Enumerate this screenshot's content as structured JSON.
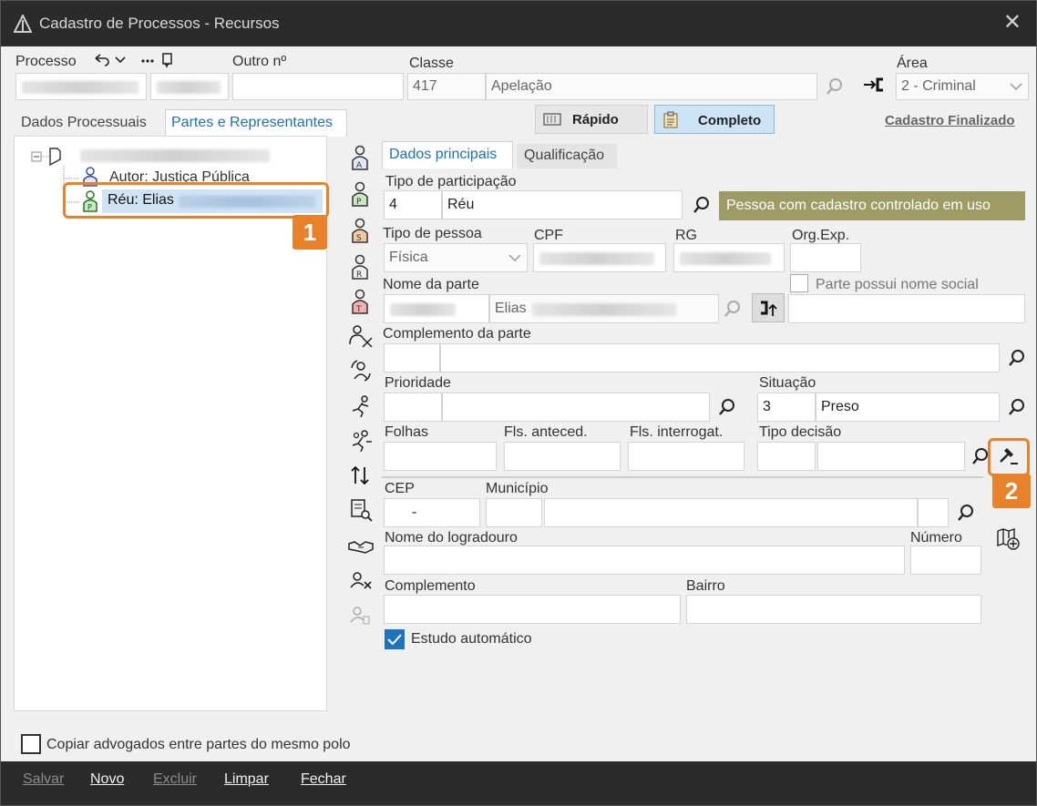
{
  "window": {
    "title": "Cadastro de Processos - Recursos",
    "close": "✕"
  },
  "header": {
    "processo_label": "Processo",
    "outro_label": "Outro nº",
    "classe_label": "Classe",
    "classe_code": "417",
    "classe_name": "Apelação",
    "area_label": "Área",
    "area_value": "2 - Criminal"
  },
  "tabs": {
    "dados_processuais": "Dados Processuais",
    "partes": "Partes e Representantes"
  },
  "mode": {
    "rapido": "Rápido",
    "completo": "Completo",
    "finalizado": "Cadastro Finalizado"
  },
  "tree": {
    "autor": "Autor: Justiça Pública",
    "reu": "Réu: Elias"
  },
  "subtabs": {
    "principais": "Dados principais",
    "qualificacao": "Qualificação"
  },
  "form": {
    "tipo_participacao_label": "Tipo de participação",
    "tipo_participacao_code": "4",
    "tipo_participacao_value": "Réu",
    "controlled_msg": "Pessoa com cadastro controlado em uso",
    "tipo_pessoa_label": "Tipo de pessoa",
    "tipo_pessoa_value": "Física",
    "cpf_label": "CPF",
    "rg_label": "RG",
    "orgexp_label": "Org.Exp.",
    "nome_parte_label": "Nome da parte",
    "nome_parte_value": "Elias",
    "nome_social_label": "Parte possui nome social",
    "complemento_parte_label": "Complemento da parte",
    "prioridade_label": "Prioridade",
    "situacao_label": "Situação",
    "situacao_code": "3",
    "situacao_value": "Preso",
    "folhas_label": "Folhas",
    "fls_anteced_label": "Fls. anteced.",
    "fls_interrog_label": "Fls. interrogat.",
    "tipo_decisao_label": "Tipo decisão",
    "cep_label": "CEP",
    "cep_value": "-",
    "municipio_label": "Município",
    "logradouro_label": "Nome do logradouro",
    "numero_label": "Número",
    "complemento_label": "Complemento",
    "bairro_label": "Bairro",
    "estudo_label": "Estudo automático"
  },
  "copiar_label": "Copiar advogados entre partes do mesmo polo",
  "footer": {
    "salvar": "Salvar",
    "novo": "Novo",
    "excluir": "Excluir",
    "limpar": "Limpar",
    "fechar": "Fechar"
  },
  "callouts": {
    "one": "1",
    "two": "2"
  },
  "colors": {
    "accent": "#e8822a",
    "controlled_bg": "#9c9c64",
    "selected": "#cfe3f5",
    "mode_active": "#cde4f7"
  }
}
